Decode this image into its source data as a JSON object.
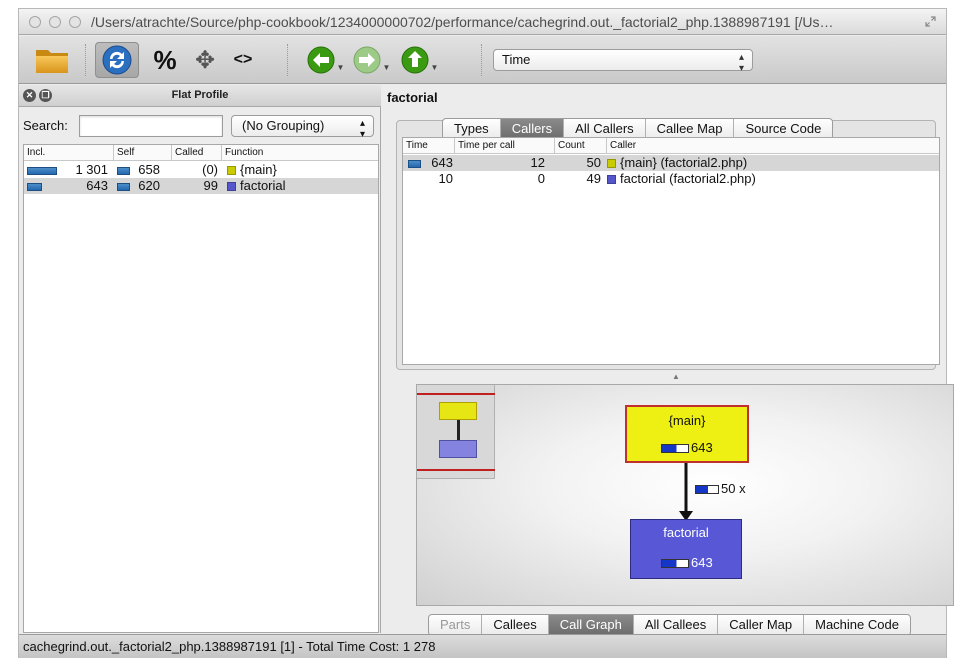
{
  "window": {
    "title": "/Users/atrachte/Source/php-cookbook/1234000000702/performance/cachegrind.out._factorial2_php.1388987191 [/Us…"
  },
  "toolbar": {
    "percent_label": "%",
    "move_label": "✥",
    "code_label": "<>",
    "metric_selected": "Time"
  },
  "flat_profile": {
    "title": "Flat Profile",
    "search_label": "Search:",
    "search_value": "",
    "grouping_selected": "(No Grouping)",
    "columns": [
      "Incl.",
      "Self",
      "Called",
      "Function"
    ],
    "rows": [
      {
        "incl": "1 301",
        "self": "658",
        "called": "(0)",
        "function": "{main}",
        "color": "#c8cc00",
        "incl_fraction": 1.0,
        "self_fraction": 0.5,
        "selected": false
      },
      {
        "incl": "643",
        "self": "620",
        "called": "99",
        "function": "factorial",
        "color": "#5656cc",
        "incl_fraction": 0.49,
        "self_fraction": 0.48,
        "selected": true
      }
    ]
  },
  "detail": {
    "function_name": "factorial",
    "top_tabs": [
      {
        "label": "Types",
        "active": false
      },
      {
        "label": "Callers",
        "active": true
      },
      {
        "label": "All Callers",
        "active": false
      },
      {
        "label": "Callee Map",
        "active": false
      },
      {
        "label": "Source Code",
        "active": false
      }
    ],
    "caller_columns": [
      "Time",
      "Time per call",
      "Count",
      "Caller"
    ],
    "callers": [
      {
        "time": "643",
        "per_call": "12",
        "count": "50",
        "caller": "{main} (factorial2.php)",
        "color": "#c8cc00",
        "selected": true,
        "has_bar": true
      },
      {
        "time": "10",
        "per_call": "0",
        "count": "49",
        "caller": "factorial (factorial2.php)",
        "color": "#5656cc",
        "selected": false,
        "has_bar": false
      }
    ],
    "call_graph": {
      "caller_node": {
        "label": "{main}",
        "value": "643",
        "color": "#f0f014"
      },
      "callee_node": {
        "label": "factorial",
        "value": "643",
        "color": "#5757d6"
      },
      "edge_label": "50 x"
    },
    "bottom_tabs": [
      {
        "label": "Parts",
        "active": false,
        "dim": true
      },
      {
        "label": "Callees",
        "active": false,
        "dim": false
      },
      {
        "label": "Call Graph",
        "active": true,
        "dim": false
      },
      {
        "label": "All Callees",
        "active": false,
        "dim": false
      },
      {
        "label": "Caller Map",
        "active": false,
        "dim": false
      },
      {
        "label": "Machine Code",
        "active": false,
        "dim": false
      }
    ]
  },
  "status": {
    "text": "cachegrind.out._factorial2_php.1388987191 [1] - Total Time Cost: 1 278"
  }
}
